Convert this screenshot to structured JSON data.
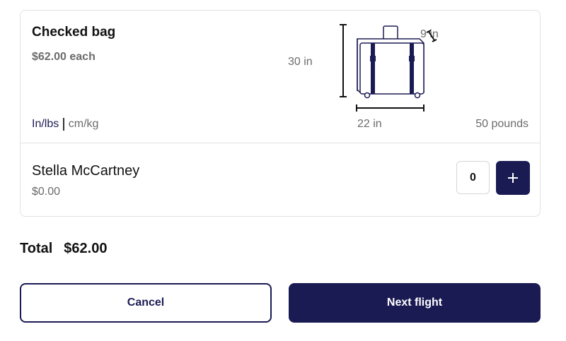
{
  "bag": {
    "title": "Checked bag",
    "price": "$62.00 each",
    "unit_active": "In/lbs",
    "unit_inactive": "cm/kg",
    "height_label": "30 in",
    "depth_label": "9 in",
    "width_label": "22 in",
    "weight_label": "50 pounds"
  },
  "passenger": {
    "name": "Stella McCartney",
    "price": "$0.00",
    "quantity": "0"
  },
  "total": {
    "label": "Total",
    "amount": "$62.00"
  },
  "actions": {
    "cancel_label": "Cancel",
    "next_label": "Next flight"
  },
  "icons": {
    "suitcase": "suitcase-icon",
    "plus": "plus-icon"
  },
  "colors": {
    "accent": "#1b1b54",
    "muted_text": "#6b6b6b",
    "border": "#e2e2e6"
  }
}
